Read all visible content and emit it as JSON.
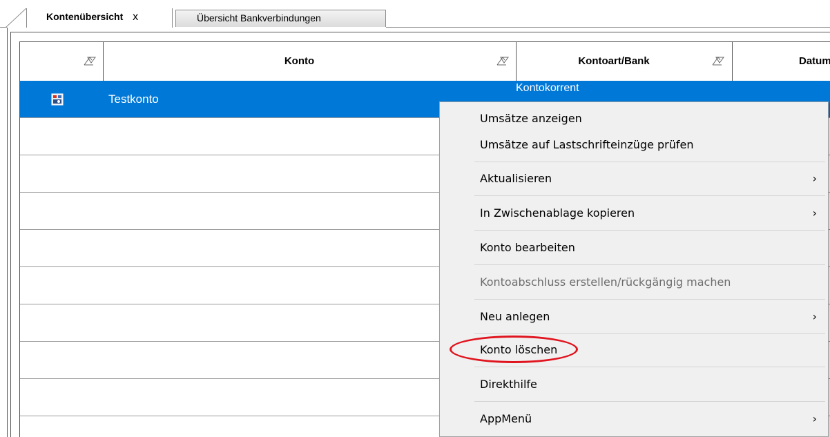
{
  "tabs": {
    "active_label": "Kontenübersicht",
    "close_glyph": "x",
    "inactive_label": "Übersicht Bankverbindungen"
  },
  "grid": {
    "columns": [
      {
        "label": ""
      },
      {
        "label": "Konto"
      },
      {
        "label": "Kontoart/Bank"
      },
      {
        "label": "Datum"
      }
    ],
    "rows": [
      {
        "name": "Testkonto",
        "type": "Kontokorrent",
        "selected": true,
        "icon": "account-icon"
      }
    ],
    "sort_icon": "sort-icon"
  },
  "context_menu": {
    "items": [
      {
        "label": "Umsätze anzeigen",
        "submenu": false,
        "disabled": false
      },
      {
        "label": "Umsätze auf Lastschrifteinzüge prüfen",
        "submenu": false,
        "disabled": false
      },
      {
        "label": "Aktualisieren",
        "submenu": true,
        "disabled": false
      },
      {
        "label": "In Zwischenablage kopieren",
        "submenu": true,
        "disabled": false
      },
      {
        "label": "Konto bearbeiten",
        "submenu": false,
        "disabled": false
      },
      {
        "label": "Kontoabschluss erstellen/rückgängig machen",
        "submenu": false,
        "disabled": true
      },
      {
        "label": "Neu anlegen",
        "submenu": true,
        "disabled": false
      },
      {
        "label": "Konto löschen",
        "submenu": false,
        "disabled": false,
        "highlighted": true
      },
      {
        "label": "Direkthilfe",
        "submenu": false,
        "disabled": false
      },
      {
        "label": "AppMenü",
        "submenu": true,
        "disabled": false
      }
    ],
    "submenu_arrow": "›"
  },
  "colors": {
    "selection": "#0078d7",
    "highlight_ring": "#e0141e",
    "menu_background": "#f0f0f0"
  }
}
